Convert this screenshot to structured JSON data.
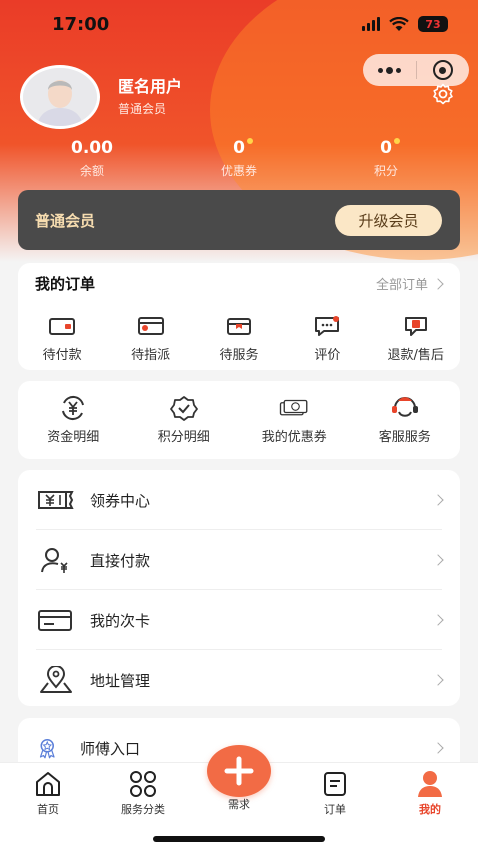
{
  "status_bar": {
    "time": "17:00",
    "battery": "73"
  },
  "colors": {
    "brand": "#ea3c28",
    "accent": "#f26b45",
    "member_bar": "#4a4a4a",
    "gold_text": "#f7ddb0"
  },
  "profile": {
    "name": "匿名用户",
    "level": "普通会员"
  },
  "stats": [
    {
      "value": "0.00",
      "label": "余额",
      "dot": false
    },
    {
      "value": "0",
      "label": "优惠券",
      "dot": true
    },
    {
      "value": "0",
      "label": "积分",
      "dot": true
    }
  ],
  "member_bar": {
    "title": "普通会员",
    "upgrade_label": "升级会员"
  },
  "orders": {
    "title": "我的订单",
    "all_label": "全部订单",
    "items": [
      {
        "label": "待付款",
        "icon": "wallet-icon"
      },
      {
        "label": "待指派",
        "icon": "card-assign-icon"
      },
      {
        "label": "待服务",
        "icon": "service-box-icon"
      },
      {
        "label": "评价",
        "icon": "comment-icon"
      },
      {
        "label": "退款/售后",
        "icon": "refund-icon"
      }
    ]
  },
  "tools": [
    {
      "label": "资金明细",
      "icon": "yuan-refresh-icon"
    },
    {
      "label": "积分明细",
      "icon": "badge-check-icon"
    },
    {
      "label": "我的优惠券",
      "icon": "coupon-icon"
    },
    {
      "label": "客服服务",
      "icon": "customer-service-icon"
    }
  ],
  "menu": [
    {
      "label": "领券中心",
      "icon": "ticket-icon"
    },
    {
      "label": "直接付款",
      "icon": "user-pay-icon"
    },
    {
      "label": "我的次卡",
      "icon": "card-icon"
    },
    {
      "label": "地址管理",
      "icon": "location-icon"
    }
  ],
  "master": {
    "label": "师傅入口",
    "icon": "medal-icon"
  },
  "tabbar": {
    "items": [
      {
        "label": "首页",
        "icon": "home-icon"
      },
      {
        "label": "服务分类",
        "icon": "grid-icon"
      },
      {
        "label": "需求",
        "icon": "plus-icon"
      },
      {
        "label": "订单",
        "icon": "order-icon"
      },
      {
        "label": "我的",
        "icon": "profile-icon"
      }
    ]
  }
}
